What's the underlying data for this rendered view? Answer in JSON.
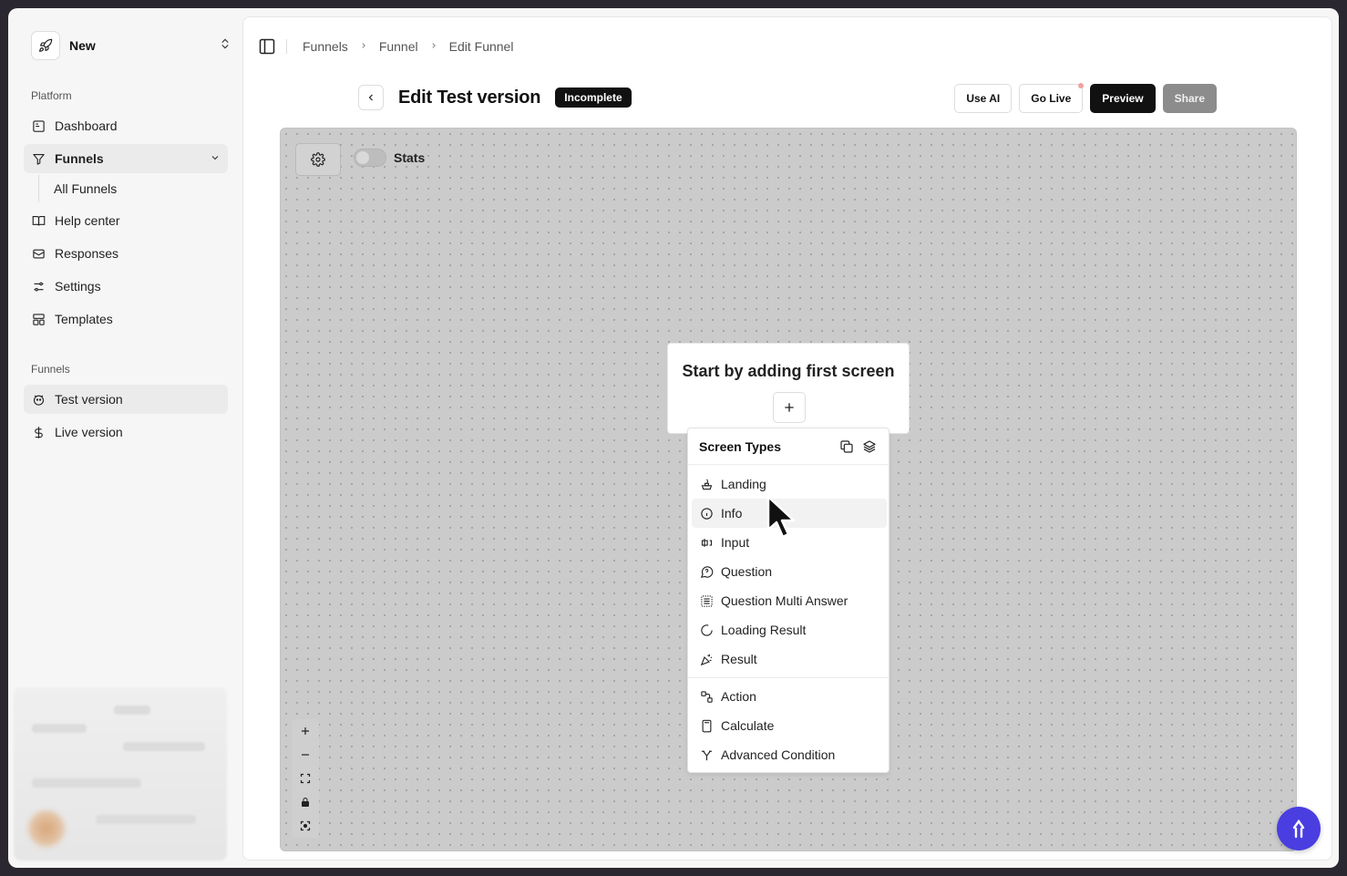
{
  "team": {
    "name": "New",
    "logo_icon": "rocket-icon"
  },
  "sidebar": {
    "platform_label": "Platform",
    "items": [
      {
        "label": "Dashboard",
        "icon": "dashboard-icon"
      },
      {
        "label": "Funnels",
        "icon": "funnel-icon"
      },
      {
        "label": "Help center",
        "icon": "book-icon"
      },
      {
        "label": "Responses",
        "icon": "inbox-icon"
      },
      {
        "label": "Settings",
        "icon": "sliders-icon"
      },
      {
        "label": "Templates",
        "icon": "layout-icon"
      }
    ],
    "funnels_subitems": [
      "All Funnels"
    ],
    "funnels_section_label": "Funnels",
    "funnel_versions": [
      {
        "label": "Test version",
        "icon": "test-icon"
      },
      {
        "label": "Live version",
        "icon": "dollar-icon"
      }
    ]
  },
  "breadcrumb": [
    "Funnels",
    "Funnel",
    "Edit Funnel"
  ],
  "header": {
    "title": "Edit Test version",
    "status_badge": "Incomplete"
  },
  "actions": {
    "use_ai": "Use AI",
    "go_live": "Go Live",
    "preview": "Preview",
    "share": "Share"
  },
  "canvas": {
    "stats_label": "Stats",
    "start_card_title": "Start by adding first screen"
  },
  "menu": {
    "title": "Screen Types",
    "items": [
      {
        "label": "Landing",
        "icon": "landing-icon"
      },
      {
        "label": "Info",
        "icon": "info-icon"
      },
      {
        "label": "Input",
        "icon": "input-icon"
      },
      {
        "label": "Question",
        "icon": "question-icon"
      },
      {
        "label": "Question Multi Answer",
        "icon": "multi-answer-icon"
      },
      {
        "label": "Loading Result",
        "icon": "loading-icon"
      },
      {
        "label": "Result",
        "icon": "confetti-icon"
      }
    ],
    "logic_items": [
      {
        "label": "Action",
        "icon": "action-icon"
      },
      {
        "label": "Calculate",
        "icon": "calculator-icon"
      },
      {
        "label": "Advanced Condition",
        "icon": "branch-icon"
      }
    ]
  },
  "colors": {
    "accent": "#4a3ee0",
    "badge_bg": "#111111",
    "canvas_bg": "#cbcbcb"
  }
}
